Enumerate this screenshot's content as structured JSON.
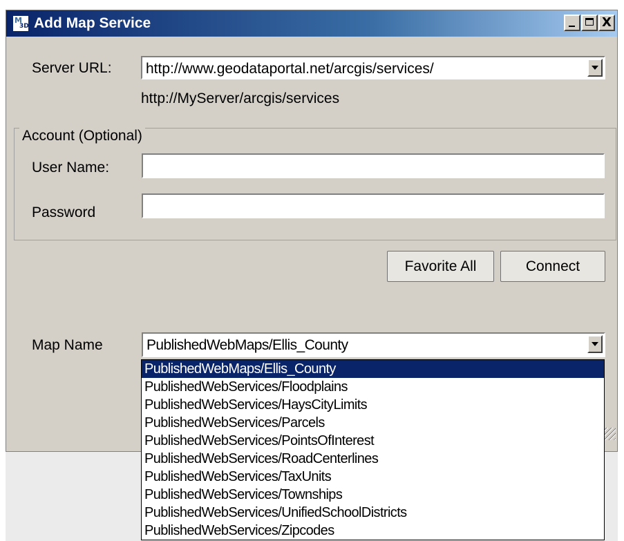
{
  "window": {
    "title": "Add Map Service",
    "icon": "map-3d-icon",
    "icon_text_top": "M",
    "icon_text_bottom": "3D",
    "close_glyph": "X"
  },
  "server": {
    "label": "Server URL:",
    "value": "http://www.geodataportal.net/arcgis/services/",
    "hint": "http://MyServer/arcgis/services"
  },
  "account": {
    "legend": "Account (Optional)",
    "username_label": "User Name:",
    "username_value": "",
    "password_label": "Password",
    "password_value": ""
  },
  "buttons": {
    "favorite_all": "Favorite All",
    "connect": "Connect"
  },
  "map": {
    "label": "Map Name",
    "value": "PublishedWebMaps/Ellis_County",
    "options": [
      "PublishedWebMaps/Ellis_County",
      "PublishedWebServices/Floodplains",
      "PublishedWebServices/HaysCityLimits",
      "PublishedWebServices/Parcels",
      "PublishedWebServices/PointsOfInterest",
      "PublishedWebServices/RoadCenterlines",
      "PublishedWebServices/TaxUnits",
      "PublishedWebServices/Townships",
      "PublishedWebServices/UnifiedSchoolDistricts",
      "PublishedWebServices/Zipcodes"
    ],
    "selected_index": 0
  },
  "colors": {
    "title_bar": "#0a246a",
    "dialog_bg": "#d4d0c8",
    "selection": "#0a246a"
  }
}
